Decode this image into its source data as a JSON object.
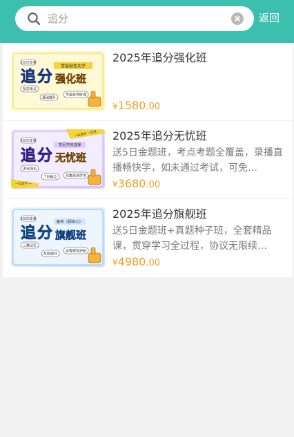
{
  "search": {
    "query": "追分"
  },
  "header": {
    "back_label": "返回"
  },
  "accent_color": "#3cbfae",
  "price_color": "#f29c1f",
  "courses": [
    {
      "title": "2025年追分强化班",
      "desc": "",
      "currency": "¥",
      "price_int": "1580",
      "price_dec": ".00",
      "thumb": {
        "theme": "yellow",
        "badge": "2025年考",
        "top_tag": "零基础性先学",
        "big1": "追",
        "big2": "分",
        "sub": "强化班",
        "pills": [
          "锁定考点",
          "基础提升",
          "专属名师好课"
        ]
      }
    },
    {
      "title": "2025年追分无忧班",
      "desc": "送5日金题班，考点考题全覆盖，录播直播畅快学，如未通过考试，可免…",
      "currency": "¥",
      "price_int": "3680",
      "price_dec": ".00",
      "thumb": {
        "theme": "purple",
        "badge": "2025年考",
        "top_tag": "学员共同选择",
        "big1": "追",
        "big2": "分",
        "sub": "无忧班",
        "pills": [
          "追分强化",
          "7日精点",
          "双重高效伴学"
        ],
        "ribbon1": "一年退学 一年退",
        "ribbon2": "一年退学 一"
      }
    },
    {
      "title": "2025年追分旗舰班",
      "desc": "送5日金题班+真题种子班，全套精品课，贯穿学习全过程，协议无限续…",
      "currency": "¥",
      "price_int": "4980",
      "price_dec": ".00",
      "thumb": {
        "theme": "blue",
        "badge": "2025年考",
        "top_tag": "备考（超安心）",
        "big1": "追",
        "big2": "分",
        "sub": "旗舰班",
        "pills": [
          "三重记忆",
          "阶段提升",
          "全程保驾护航"
        ]
      }
    }
  ]
}
